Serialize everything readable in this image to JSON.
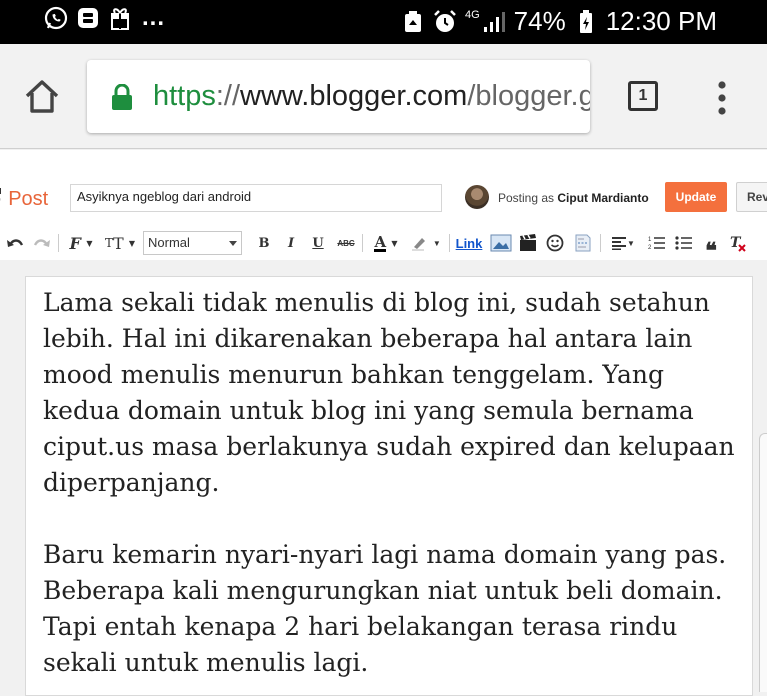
{
  "status_bar": {
    "overflow": "...",
    "network": "4G",
    "battery": "74%",
    "time": "12:30 PM",
    "left_icons": [
      "whatsapp-icon",
      "b-badge-icon",
      "gift-icon"
    ],
    "right_icons": [
      "recycle-icon",
      "alarm-icon",
      "signal-icon",
      "battery-icon"
    ]
  },
  "browser": {
    "url_scheme": "https",
    "url_sep": "://",
    "url_host": "www.blogger.com",
    "url_path": "/blogger.g",
    "tab_count": "1",
    "secure_color": "#1e8e3e"
  },
  "blogger": {
    "dot": "· ",
    "post_label": "Post",
    "title_value": "Asyiknya ngeblog dari android",
    "posting_as_prefix": "Posting as ",
    "author": "Ciput Mardianto",
    "update_label": "Update",
    "revert_label": "Reve",
    "accent_color": "#f4703d"
  },
  "toolbar": {
    "font_size_value": "Normal",
    "link_label": "Link",
    "bold": "B",
    "italic": "I",
    "underline": "U",
    "strike": "ABC",
    "font_letter": "F",
    "size_letter": "T",
    "text_color_letter": "A"
  },
  "editor": {
    "paragraphs": [
      "Lama sekali tidak menulis di blog ini, sudah setahun lebih. Hal ini dikarenakan beberapa hal antara lain mood menulis menurun bahkan tenggelam. Yang kedua domain untuk blog ini yang semula bernama ciput.us masa berlakunya sudah expired dan kelupaan diperpanjang.",
      "Baru kemarin nyari-nyari lagi nama domain yang pas. Beberapa kali mengurungkan niat untuk beli domain. Tapi entah kenapa 2 hari belakangan terasa rindu sekali untuk menulis lagi."
    ]
  }
}
